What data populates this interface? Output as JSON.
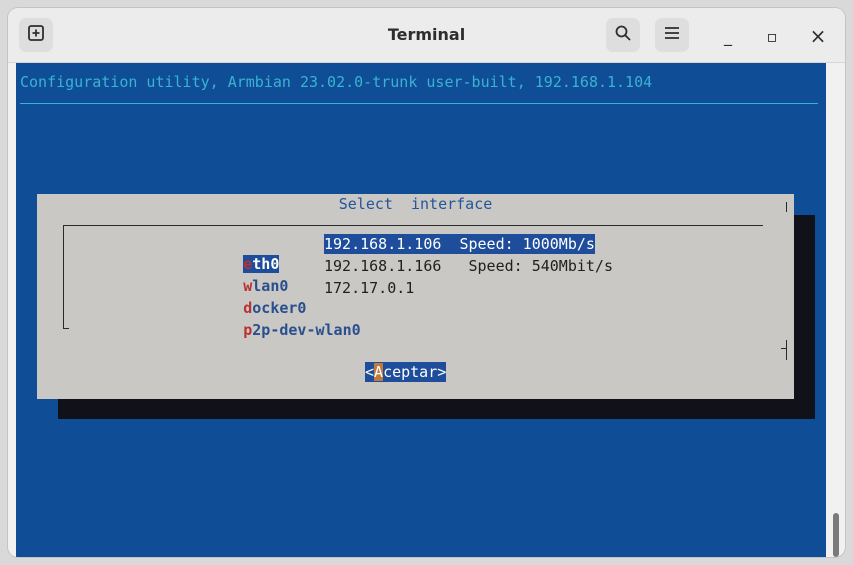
{
  "window": {
    "title": "Terminal",
    "new_tab_icon": "plus-box-icon",
    "search_icon": "search-icon",
    "menu_icon": "hamburger-menu-icon",
    "minimize": "_",
    "maximize": "▫",
    "close": "×"
  },
  "terminal": {
    "header": "Configuration utility, Armbian 23.02.0-trunk user-built, 192.168.1.104",
    "dialog": {
      "title": "Select  interface",
      "items": [
        {
          "hotkey": "e",
          "rest": "th0",
          "info": "192.168.1.106  Speed: 1000Mb/s",
          "selected": true
        },
        {
          "hotkey": "w",
          "rest": "lan0",
          "info": "192.168.1.166   Speed: 540Mbit/s",
          "selected": false
        },
        {
          "hotkey": "d",
          "rest": "ocker0",
          "info": "172.17.0.1",
          "selected": false
        },
        {
          "hotkey": "p",
          "rest": "2p-dev-wlan0",
          "info": "",
          "selected": false
        }
      ],
      "ok_button": {
        "open": "<",
        "hotkey": "A",
        "rest": "ceptar",
        "close": ">"
      }
    }
  },
  "colors": {
    "terminal_bg": "#0f4d96",
    "header_fg": "#39b3d2",
    "dialog_bg": "#c9c8c5",
    "selection_bg": "#1d4d9b",
    "hotkey_fg": "#b93232"
  }
}
